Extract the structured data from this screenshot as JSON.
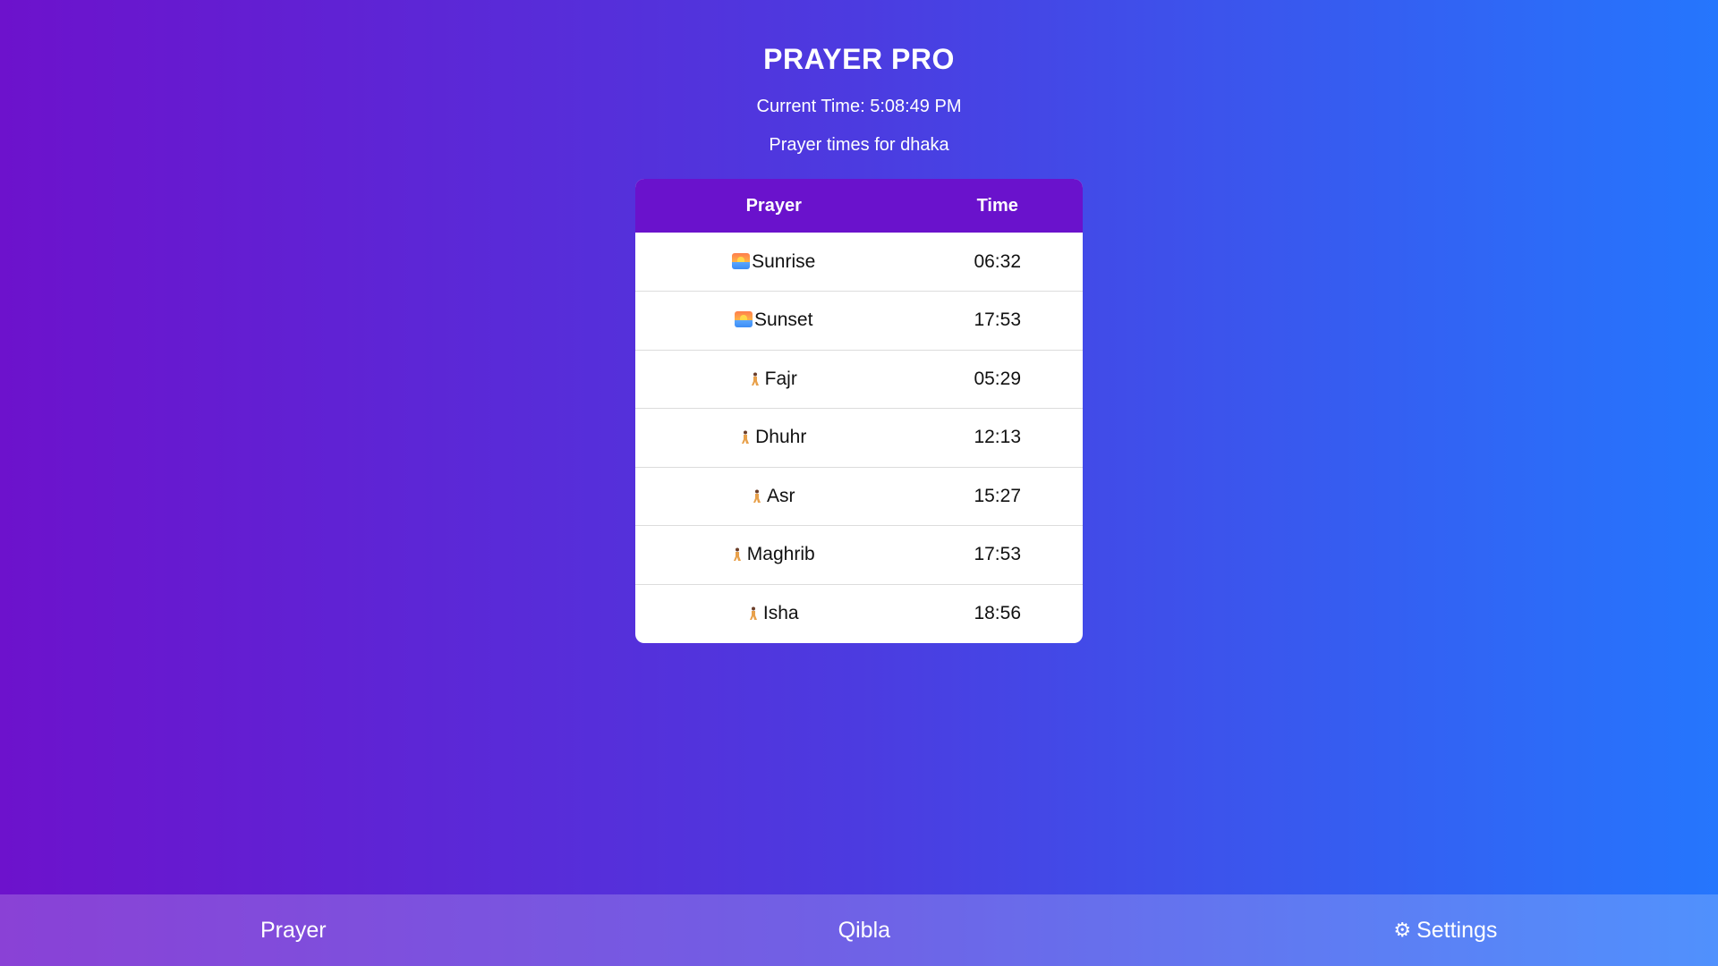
{
  "app": {
    "title": "PRAYER PRO",
    "current_time_label": "Current Time: 5:08:49 PM",
    "location_label": "Prayer times for dhaka"
  },
  "table": {
    "headers": {
      "prayer": "Prayer",
      "time": "Time"
    },
    "rows": [
      {
        "icon": "sunrise-icon",
        "name": "Sunrise",
        "time": "06:32"
      },
      {
        "icon": "sunrise-icon",
        "name": "Sunset",
        "time": "17:53"
      },
      {
        "icon": "person-kneeling-icon",
        "name": "Fajr",
        "time": "05:29"
      },
      {
        "icon": "person-kneeling-icon",
        "name": "Dhuhr",
        "time": "12:13"
      },
      {
        "icon": "person-kneeling-icon",
        "name": "Asr",
        "time": "15:27"
      },
      {
        "icon": "person-kneeling-icon",
        "name": "Maghrib",
        "time": "17:53"
      },
      {
        "icon": "person-kneeling-icon",
        "name": "Isha",
        "time": "18:56"
      }
    ]
  },
  "nav": {
    "prayer_label": "Prayer",
    "qibla_label": "Qibla",
    "settings_label": "Settings",
    "settings_icon": "gear-icon"
  },
  "colors": {
    "gradient_start": "#6d12cc",
    "gradient_end": "#2576fd",
    "table_header": "#6a12cc"
  }
}
